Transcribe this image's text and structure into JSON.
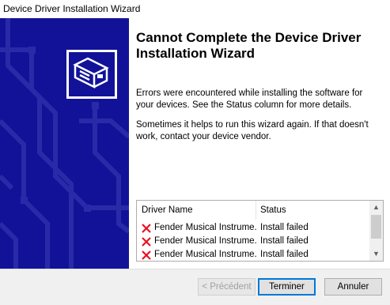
{
  "window": {
    "title": "Device Driver Installation Wizard"
  },
  "colors": {
    "side_panel": "#121299",
    "accent": "#0078d7",
    "error": "#e81123"
  },
  "main": {
    "heading": "Cannot Complete the Device Driver Installation Wizard",
    "paragraph1": "Errors were encountered while installing the software for your devices. See the Status column for more details.",
    "paragraph2": "Sometimes it helps to run this wizard again. If that doesn't work, contact your device vendor."
  },
  "driver_list": {
    "columns": [
      "Driver Name",
      "Status"
    ],
    "rows": [
      {
        "icon": "error-x-icon",
        "name": "Fender Musical Instrume...",
        "status": "Install failed"
      },
      {
        "icon": "error-x-icon",
        "name": "Fender Musical Instrume...",
        "status": "Install failed"
      },
      {
        "icon": "error-x-icon",
        "name": "Fender Musical Instrume...",
        "status": "Install failed"
      }
    ],
    "scroll_up": "▲",
    "scroll_down": "▼"
  },
  "buttons": {
    "previous": "< Précédent",
    "finish": "Terminer",
    "cancel": "Annuler"
  }
}
